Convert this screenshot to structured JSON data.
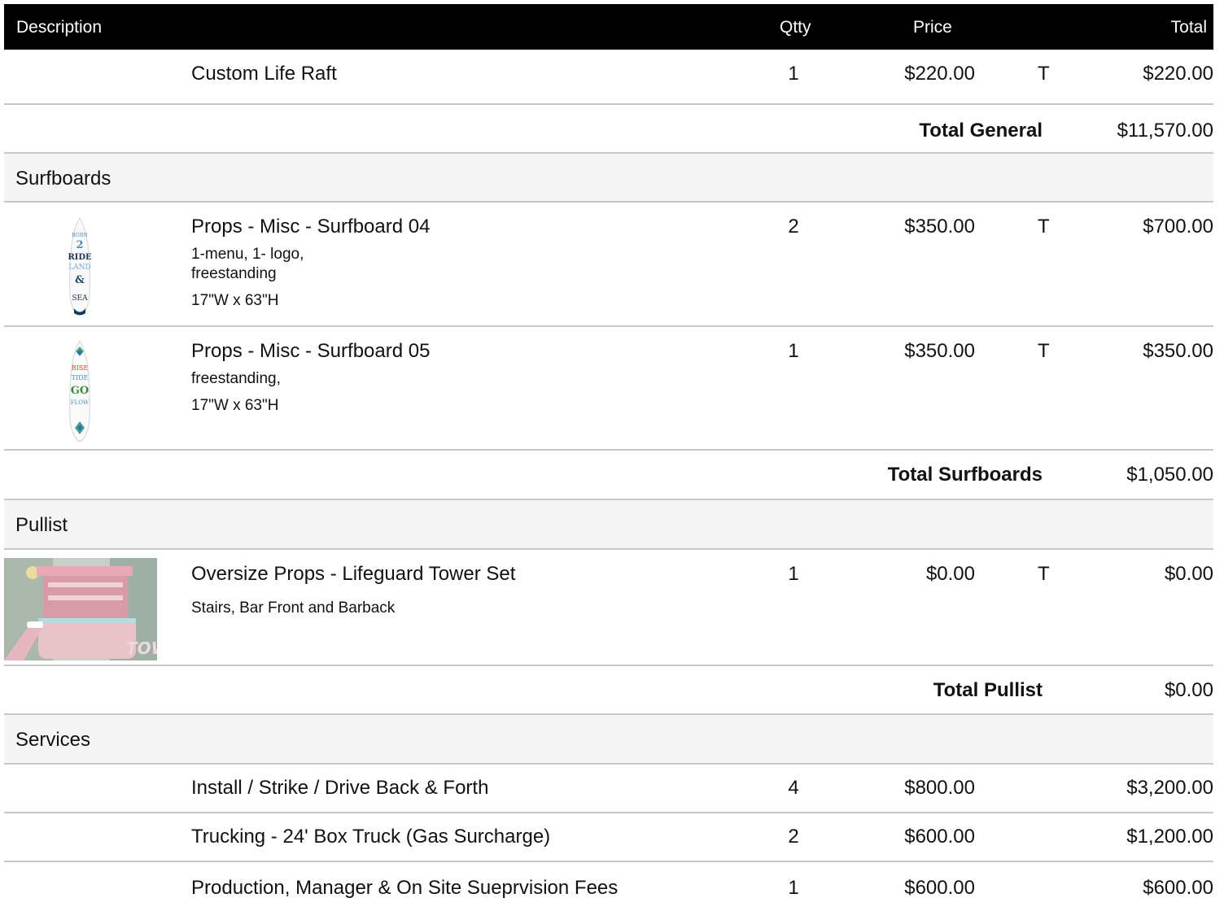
{
  "header": {
    "description": "Description",
    "qtty": "Qtty",
    "price": "Price",
    "total": "Total"
  },
  "rows": [
    {
      "kind": "item",
      "description": "Custom Life Raft",
      "qty": "1",
      "price": "$220.00",
      "tax": "T",
      "total": "$220.00"
    },
    {
      "kind": "subtotal",
      "label": "Total General",
      "total": "$11,570.00"
    },
    {
      "kind": "section",
      "name": "Surfboards"
    },
    {
      "kind": "item",
      "description": "Props - Misc - Surfboard 04",
      "notes": [
        "1-menu, 1- logo,",
        "freestanding",
        "17\"W x 63\"H"
      ],
      "qty": "2",
      "price": "$350.00",
      "tax": "T",
      "total": "$700.00",
      "image_text": [
        "BORN",
        "2",
        "RIDE",
        "LAND",
        "&",
        "SEA"
      ]
    },
    {
      "kind": "item",
      "description": "Props - Misc - Surfboard 05",
      "notes": [
        "freestanding,",
        "17\"W x 63\"H"
      ],
      "qty": "1",
      "price": "$350.00",
      "tax": "T",
      "total": "$350.00",
      "image_text": [
        "RISE",
        "TIDE",
        "GO",
        "FLOW"
      ]
    },
    {
      "kind": "subtotal",
      "label": "Total Surfboards",
      "total": "$1,050.00"
    },
    {
      "kind": "section",
      "name": "Pullist"
    },
    {
      "kind": "item",
      "description": "Oversize Props - Lifeguard Tower Set",
      "notes": [
        "Stairs, Bar Front and Barback"
      ],
      "qty": "1",
      "price": "$0.00",
      "tax": "T",
      "total": "$0.00"
    },
    {
      "kind": "subtotal",
      "label": "Total Pullist",
      "total": "$0.00"
    },
    {
      "kind": "section",
      "name": "Services"
    },
    {
      "kind": "item",
      "description": "Install / Strike / Drive Back & Forth",
      "qty": "4",
      "price": "$800.00",
      "total": "$3,200.00"
    },
    {
      "kind": "item",
      "description": "Trucking - 24' Box Truck (Gas Surcharge)",
      "qty": "2",
      "price": "$600.00",
      "total": "$1,200.00"
    },
    {
      "kind": "item",
      "description": "Production, Manager & On Site Sueprvision Fees",
      "qty": "1",
      "price": "$600.00",
      "total": "$600.00"
    }
  ]
}
